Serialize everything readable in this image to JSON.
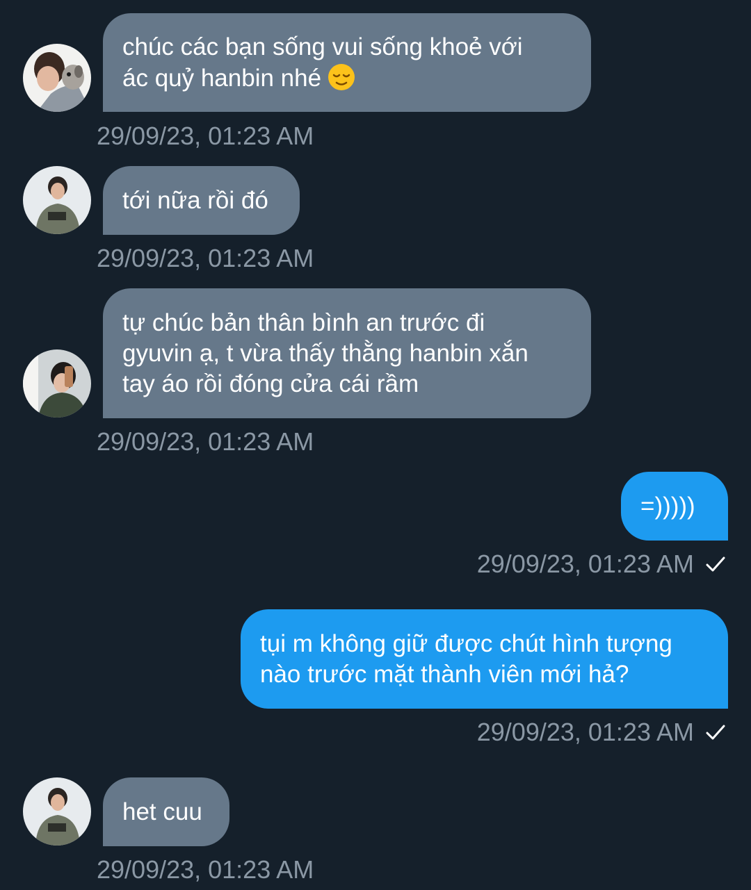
{
  "messages": [
    {
      "direction": "incoming",
      "lines": [
        "chúc các bạn sống vui sống khoẻ với",
        "ác quỷ hanbin nhé"
      ],
      "emoji": "relieved-face",
      "timestamp": "29/09/23, 01:23 AM"
    },
    {
      "direction": "incoming",
      "lines": [
        "tới nữa rồi đó"
      ],
      "timestamp": "29/09/23, 01:23 AM"
    },
    {
      "direction": "incoming",
      "lines": [
        "tự chúc bản thân bình an trước đi",
        "gyuvin ạ, t vừa thấy thằng hanbin xắn",
        "tay áo rồi đóng cửa cái rầm"
      ],
      "timestamp": "29/09/23, 01:23 AM"
    },
    {
      "direction": "outgoing",
      "lines": [
        "=)))))"
      ],
      "timestamp": "29/09/23, 01:23 AM",
      "status_icon": "check-icon"
    },
    {
      "direction": "outgoing",
      "lines": [
        "tụi m không giữ được chút hình tượng",
        "nào trước mặt thành viên mới hả?"
      ],
      "timestamp": "29/09/23, 01:23 AM",
      "status_icon": "check-icon"
    },
    {
      "direction": "incoming",
      "lines": [
        "het cuu"
      ],
      "timestamp": "29/09/23, 01:23 AM"
    }
  ],
  "colors": {
    "background": "#15202b",
    "incoming_bubble": "#66788a",
    "outgoing_bubble": "#1d9bf0",
    "timestamp": "#8b98a5"
  }
}
